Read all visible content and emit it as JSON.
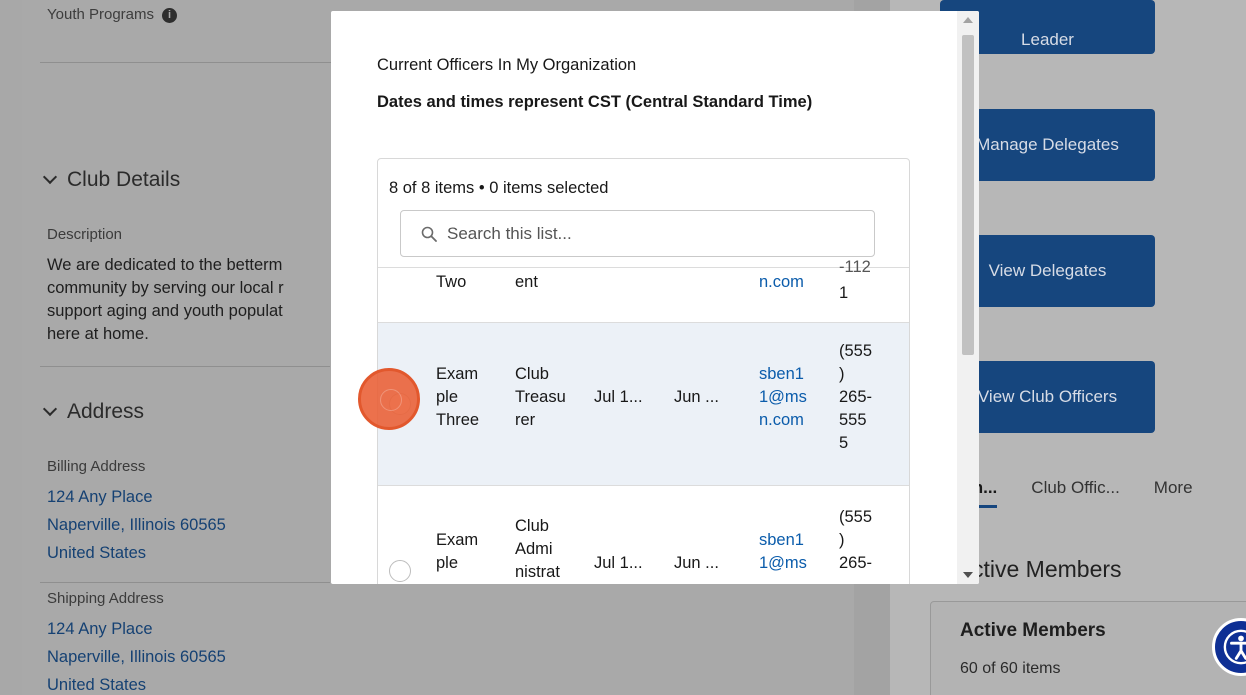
{
  "background": {
    "youth_programs": "Youth Programs",
    "club_details": {
      "heading": "Club Details",
      "description_label": "Description",
      "description_lines": [
        "We are dedicated to the betterm",
        "community by serving our local r",
        "support aging and youth populat",
        "here at home."
      ]
    },
    "address": {
      "heading": "Address",
      "billing_label": "Billing Address",
      "billing_lines": [
        "124 Any Place",
        "Naperville, Illinois 60565",
        "United States"
      ],
      "shipping_label": "Shipping Address",
      "shipping_lines": [
        "124 Any Place",
        "Naperville, Illinois 60565",
        "United States"
      ]
    },
    "right_buttons": [
      "Leader",
      "Manage Delegates",
      "View Delegates",
      "View Club Officers"
    ],
    "tabs": [
      "m...",
      "Club Offic...",
      "More"
    ],
    "active_members_heading": "ctive Members",
    "card_title": "Active Members",
    "card_count": "60 of 60 items"
  },
  "modal": {
    "title": "Current Officers In My Organization",
    "subtitle": "Dates and times represent CST (Central Standard Time)",
    "count_line": "8 of 8 items • 0 items selected",
    "search_placeholder": "Search this list...",
    "rows": [
      {
        "name": "Two",
        "role": "ent",
        "start": "",
        "end": "",
        "email": "n.com",
        "phone": "1"
      },
      {
        "name": "Exam\nple\nThree",
        "role": "Club\nTreasu\nrer",
        "start": "Jul 1...",
        "end": "Jun ...",
        "email": "sben1\n1@ms\nn.com",
        "phone": "(555\n)\n265-\n555\n5"
      },
      {
        "name": "Exam\nple",
        "role": "Club\nAdmi\nnistrat",
        "start": "Jul 1...",
        "end": "Jun ...",
        "email": "sben1\n1@ms",
        "phone": "(555\n)\n265-"
      }
    ]
  },
  "colors": {
    "brand_blue": "#16467e",
    "link_blue": "#0b5cab",
    "click_marker": "#ea6238",
    "accessibility_blue": "#0e2f94"
  }
}
